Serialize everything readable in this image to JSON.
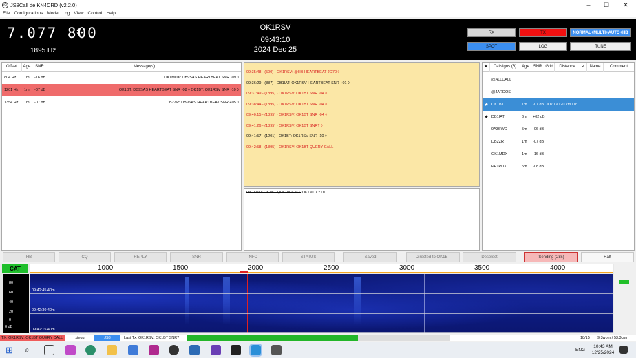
{
  "window": {
    "title": "JS8Call de KN4CRD (v2.2.0)",
    "minimize": "–",
    "maximize": "☐",
    "close": "✕"
  },
  "menu": [
    "File",
    "Configurations",
    "Mode",
    "Log",
    "View",
    "Control",
    "Help"
  ],
  "header": {
    "frequency": "7.077 800",
    "offset": "1895 Hz",
    "callsign": "OK1RSV",
    "time": "09:43:10",
    "date": "2024 Dec 25",
    "buttons": {
      "rx": "RX",
      "tx": "TX",
      "mode": "NORMAL+MULTI+AUTO+HB",
      "spot": "SPOT",
      "log": "LOG",
      "tune": "TUNE"
    },
    "colors": {
      "tx": "#f01010",
      "mode": "#3b8ef0",
      "spot": "#3b8ef0"
    }
  },
  "activity": {
    "columns": [
      "Offset",
      "Age",
      "SNR",
      "Message(s)"
    ],
    "rows": [
      {
        "offset": "804 Hz",
        "age": "1m",
        "snr": "-16 dB",
        "message": "OK1MDX: DB9SAS HEARTBEAT SNR -09 ◊",
        "selected": false
      },
      {
        "offset": "1201 Hz",
        "age": "1m",
        "snr": "-07 dB",
        "message": "OK1BT: DB9SAS HEARTBEAT SNR -08 ◊ OK1BT: OK1RSV SNR -10 ◊",
        "selected": true
      },
      {
        "offset": "1354 Hz",
        "age": "1m",
        "snr": "-07 dB",
        "message": "DB2ZR: DB9SAS HEARTBEAT SNR +05 ◊",
        "selected": false
      }
    ]
  },
  "rx_text": [
    {
      "text": "09:35:48 - (500) - OK1RSV: @HB HEARTBEAT JO70 ◊",
      "red": true
    },
    {
      "text": "09:36:29 - (887) - DB1IAT: OK1RSV HEARTBEAT SNR +01 ◊",
      "red": false
    },
    {
      "text": "09:37:49 - (1895) - OK1RSV: OK1BT SNR -04 ◊",
      "red": true
    },
    {
      "text": "09:38:44 - (1895) - OK1RSV: OK1BT SNR -04 ◊",
      "red": true
    },
    {
      "text": "09:40:15 - (1895) - OK1RSV: OK1BT SNR -04 ◊",
      "red": true
    },
    {
      "text": "09:41:26 - (1895) - OK1RSV: OK1BT SNR? ◊",
      "red": true
    },
    {
      "text": "09:41:57 - (1201) - OK1BT: OK1RSV SNR -10 ◊",
      "red": false
    },
    {
      "text": "09:42:58 - (1895) - OK1RSV: OK1BT QUERY CALL",
      "red": true
    }
  ],
  "compose": {
    "struck": "OK1RSV: OK1BT QUERY CALL",
    "rest": " OK1MDX? DIT"
  },
  "callsigns": {
    "columns": [
      "★",
      "Callsigns (6)",
      "Age",
      "SNR",
      "Grid",
      "Distance",
      "✓",
      "Name",
      "Comment"
    ],
    "rows": [
      {
        "star": "",
        "call": "@ALLCALL",
        "age": "",
        "snr": "",
        "grid": "",
        "distance": "",
        "selected": false
      },
      {
        "star": "",
        "call": "@JARDOS",
        "age": "",
        "snr": "",
        "grid": "",
        "distance": "",
        "selected": false
      },
      {
        "star": "★",
        "call": "OK1BT",
        "age": "1m",
        "snr": "-07 dB",
        "grid": "JO70",
        "distance": "<120 km / 0°",
        "selected": true
      },
      {
        "star": "★",
        "call": "DB1IAT",
        "age": "6m",
        "snr": "+02 dB",
        "grid": "",
        "distance": "",
        "selected": false
      },
      {
        "star": "",
        "call": "9A3SWO",
        "age": "5m",
        "snr": "-06 dB",
        "grid": "",
        "distance": "",
        "selected": false
      },
      {
        "star": "",
        "call": "DB2ZR",
        "age": "1m",
        "snr": "-07 dB",
        "grid": "",
        "distance": "",
        "selected": false
      },
      {
        "star": "",
        "call": "OK1MDX",
        "age": "1m",
        "snr": "-16 dB",
        "grid": "",
        "distance": "",
        "selected": false
      },
      {
        "star": "",
        "call": "PE1PUX",
        "age": "5m",
        "snr": "-08 dB",
        "grid": "",
        "distance": "",
        "selected": false
      }
    ]
  },
  "buttons": [
    "HB",
    "CQ",
    "REPLY",
    "SNR",
    "INFO",
    "STATUS",
    "Saved",
    "Directed to OK1BT",
    "Deselect",
    "Sending (28s)",
    "Halt"
  ],
  "waterfall": {
    "cat": "CAT",
    "scale": [
      "80",
      "60",
      "40",
      "20",
      "0",
      "0 dB"
    ],
    "freq_labels": [
      "1000",
      "1500",
      "2000",
      "2500",
      "3000",
      "3500",
      "4000"
    ],
    "timestamps": [
      "09:42:45   40m",
      "09:42:30   40m",
      "09:42:15   40m"
    ]
  },
  "status": {
    "tx": "TX: OK1RSV: OK1BT QUERY CALL",
    "rig": "xiegu",
    "mode": "JS8",
    "last_tx": "Last Tx: OK1RSV: OK1BT SNR?",
    "tx_progress": 0.65,
    "count": "18/15",
    "wpm": "9.3wpm / 53.3cpm"
  },
  "taskbar": {
    "lang": "ENG",
    "time": "10:43 AM",
    "date": "12/25/2024"
  }
}
